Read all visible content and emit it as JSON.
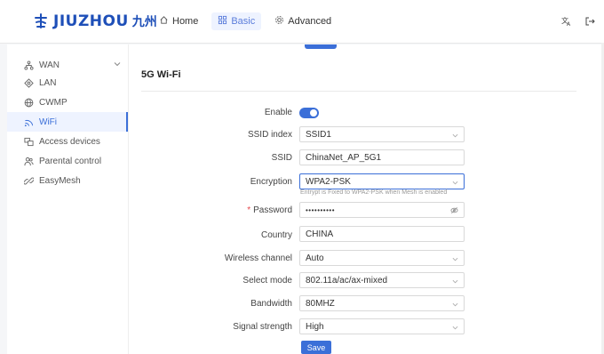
{
  "brand": {
    "name": "JIUZHOU",
    "name_cn": "九州",
    "color": "#1e4fb8"
  },
  "nav": {
    "items": [
      {
        "label": "Home",
        "icon": "home-icon",
        "active": false
      },
      {
        "label": "Basic",
        "icon": "grid-icon",
        "active": true
      },
      {
        "label": "Advanced",
        "icon": "gear-icon",
        "active": false
      }
    ]
  },
  "top_icons": [
    "translate-icon",
    "logout-icon"
  ],
  "sidebar": {
    "items": [
      {
        "label": "WAN",
        "icon": "network-icon",
        "expandable": true
      },
      {
        "label": "LAN",
        "icon": "lan-icon"
      },
      {
        "label": "CWMP",
        "icon": "globe-icon"
      },
      {
        "label": "WiFi",
        "icon": "wifi-icon",
        "active": true
      },
      {
        "label": "Access devices",
        "icon": "devices-icon"
      },
      {
        "label": "Parental control",
        "icon": "users-icon"
      },
      {
        "label": "EasyMesh",
        "icon": "mesh-icon"
      }
    ]
  },
  "section": {
    "title": "5G Wi-Fi"
  },
  "form": {
    "enable": {
      "label": "Enable",
      "value": true
    },
    "ssid_index": {
      "label": "SSID index",
      "value": "SSID1"
    },
    "ssid": {
      "label": "SSID",
      "value": "ChinaNet_AP_5G1"
    },
    "encryption": {
      "label": "Encryption",
      "value": "WPA2-PSK",
      "hint": "Entrypt is Fixed to WPA2-PSK when Mesh is enabled"
    },
    "password": {
      "label": "Password",
      "value": "••••••••••"
    },
    "country": {
      "label": "Country",
      "value": "CHINA"
    },
    "wireless_channel": {
      "label": "Wireless channel",
      "value": "Auto"
    },
    "select_mode": {
      "label": "Select mode",
      "value": "802.11a/ac/ax-mixed"
    },
    "bandwidth": {
      "label": "Bandwidth",
      "value": "80MHZ"
    },
    "signal_strength": {
      "label": "Signal strength",
      "value": "High"
    },
    "save_label": "Save"
  },
  "colors": {
    "accent": "#3b6fd8",
    "required": "#e5484d"
  }
}
